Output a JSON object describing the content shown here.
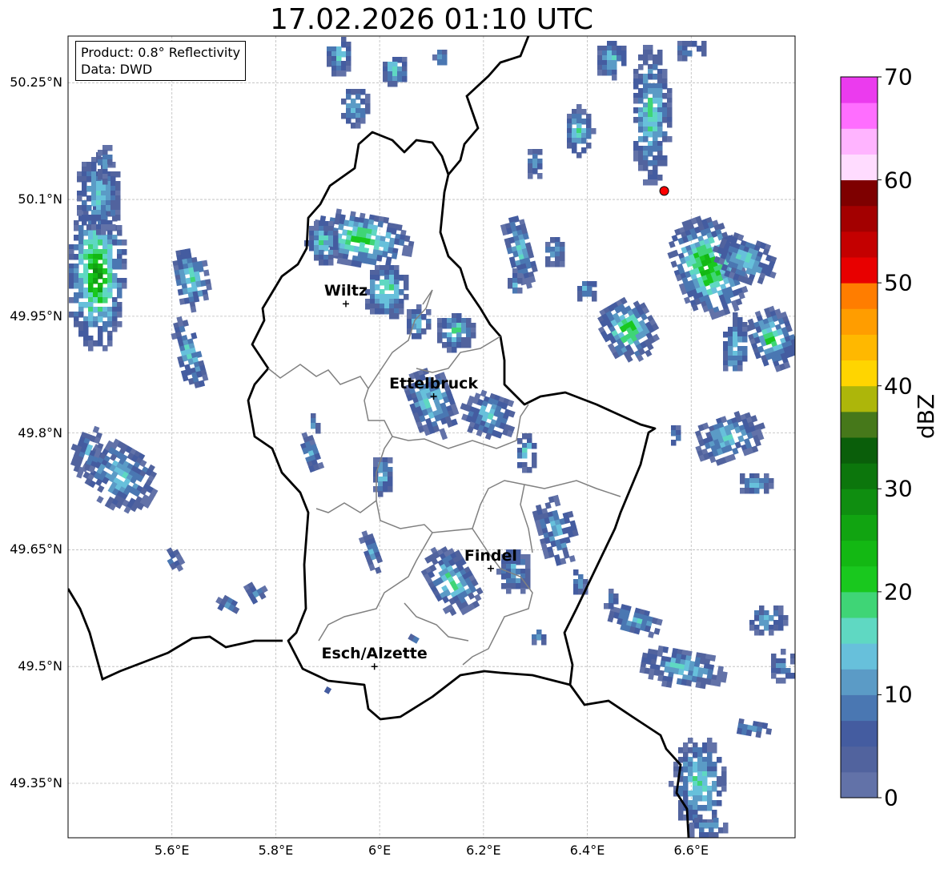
{
  "title": "17.02.2026 01:10 UTC",
  "info_box": {
    "product": "Product: 0.8° Reflectivity",
    "data": "Data: DWD"
  },
  "extent": {
    "lon": [
      5.4,
      6.8
    ],
    "lat": [
      49.28,
      50.31
    ]
  },
  "lat_ticks": [
    {
      "value": 50.25,
      "label": "50.25°N"
    },
    {
      "value": 50.1,
      "label": "50.1°N"
    },
    {
      "value": 49.95,
      "label": "49.95°N"
    },
    {
      "value": 49.8,
      "label": "49.8°N"
    },
    {
      "value": 49.65,
      "label": "49.65°N"
    },
    {
      "value": 49.5,
      "label": "49.5°N"
    },
    {
      "value": 49.35,
      "label": "49.35°N"
    }
  ],
  "lon_ticks": [
    {
      "value": 5.6,
      "label": "5.6°E"
    },
    {
      "value": 5.8,
      "label": "5.8°E"
    },
    {
      "value": 6.0,
      "label": "6°E"
    },
    {
      "value": 6.2,
      "label": "6.2°E"
    },
    {
      "value": 6.4,
      "label": "6.4°E"
    },
    {
      "value": 6.6,
      "label": "6.6°E"
    }
  ],
  "grid": true,
  "cities": [
    {
      "name": "Wiltz",
      "lon": 5.935,
      "lat": 49.966
    },
    {
      "name": "Ettelbruck",
      "lon": 6.104,
      "lat": 49.847
    },
    {
      "name": "Findel",
      "lon": 6.214,
      "lat": 49.626
    },
    {
      "name": "Esch/Alzette",
      "lon": 5.99,
      "lat": 49.5
    }
  ],
  "radar_site": {
    "lon": 6.548,
    "lat": 50.111,
    "color": "#ff0000"
  },
  "colorbar": {
    "label": "dBZ",
    "min": 0,
    "max": 70,
    "ticks": [
      "0",
      "10",
      "20",
      "30",
      "40",
      "50",
      "60",
      "70"
    ],
    "colors": [
      "#6272a8",
      "#51639e",
      "#445ca0",
      "#4a77b2",
      "#5b9bc6",
      "#67c0db",
      "#5fd8c2",
      "#3fd576",
      "#19c81e",
      "#13b813",
      "#11a411",
      "#0f8e10",
      "#0c760c",
      "#0a5e0a",
      "#46781a",
      "#adb60a",
      "#ffd500",
      "#ffb800",
      "#ff9d00",
      "#ff7d00",
      "#e80000",
      "#c40000",
      "#a30000",
      "#7e0000",
      "#ffdcff",
      "#ffb4ff",
      "#ff6eff",
      "#eb3bee"
    ]
  }
}
